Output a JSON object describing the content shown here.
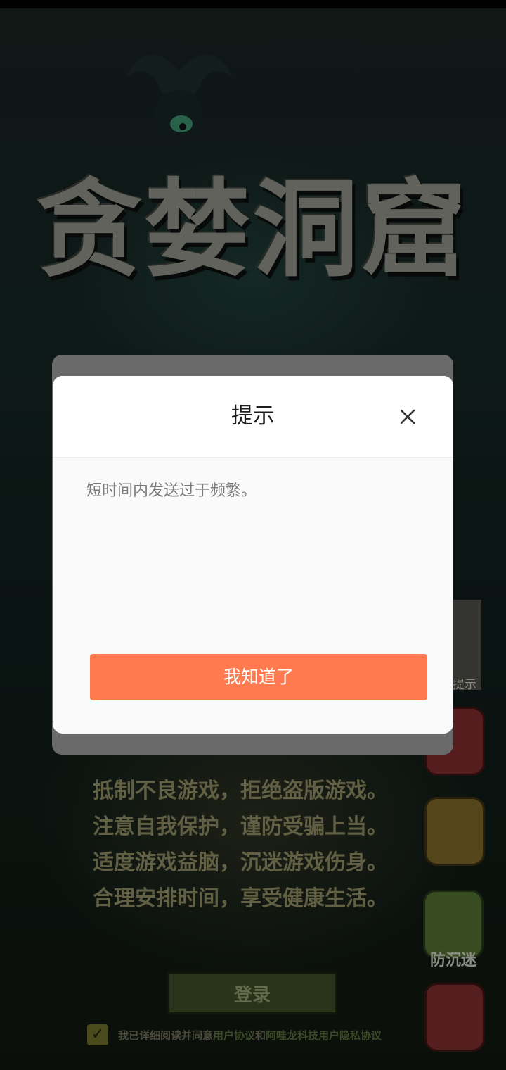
{
  "game": {
    "title": "贪婪洞窟",
    "notice_lines": [
      "抵制不良游戏，拒绝盗版游戏。",
      "注意自我保护，谨防受骗上当。",
      "适度游戏益脑，沉迷游戏伤身。",
      "合理安排时间，享受健康生活。"
    ],
    "login_label": "登录",
    "agreement": {
      "prefix": "我已详细阅读并同意",
      "user_agreement": "用户协议",
      "and": "和",
      "privacy": "阿哇龙科技用户隐私协议"
    },
    "age_tip_label": "提示",
    "anti_addiction_label": "防沉迷"
  },
  "dialog": {
    "title": "提示",
    "message": "短时间内发送过于频繁。",
    "confirm_label": "我知道了"
  },
  "colors": {
    "confirm": "#ff7a4f",
    "dialog_bg": "#fafafa"
  }
}
